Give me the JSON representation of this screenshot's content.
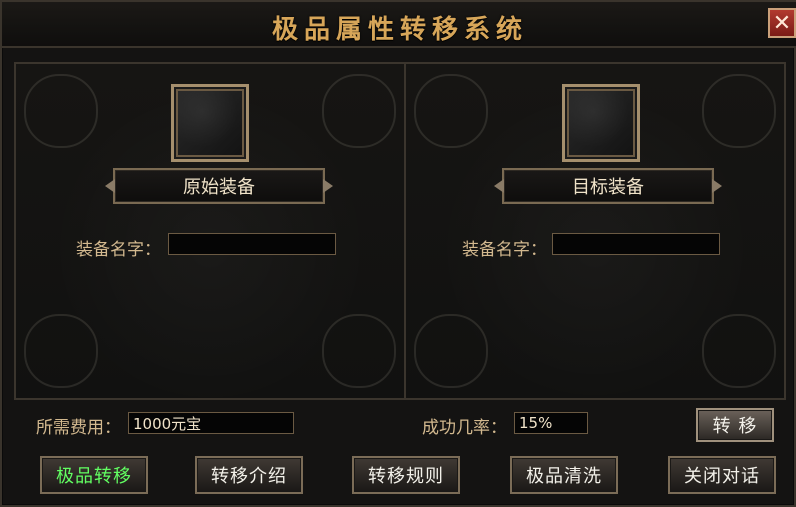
{
  "window": {
    "title": "极品属性转移系统",
    "close_label": "✕"
  },
  "left_panel": {
    "slot_label": "原始装备",
    "name_label": "装备名字：",
    "name_value": ""
  },
  "right_panel": {
    "slot_label": "目标装备",
    "name_label": "装备名字：",
    "name_value": ""
  },
  "cost": {
    "label": "所需费用：",
    "value": "1000元宝"
  },
  "success_rate": {
    "label": "成功几率：",
    "value": "15%"
  },
  "actions": {
    "transfer_label": "转 移"
  },
  "bottom_buttons": [
    {
      "label": "极品转移",
      "color": "#62ff62"
    },
    {
      "label": "转移介绍",
      "color": "#f3f1ea"
    },
    {
      "label": "转移规则",
      "color": "#f3f1ea"
    },
    {
      "label": "极品清洗",
      "color": "#f3f1ea"
    },
    {
      "label": "关闭对话",
      "color": "#f3f1ea"
    }
  ]
}
